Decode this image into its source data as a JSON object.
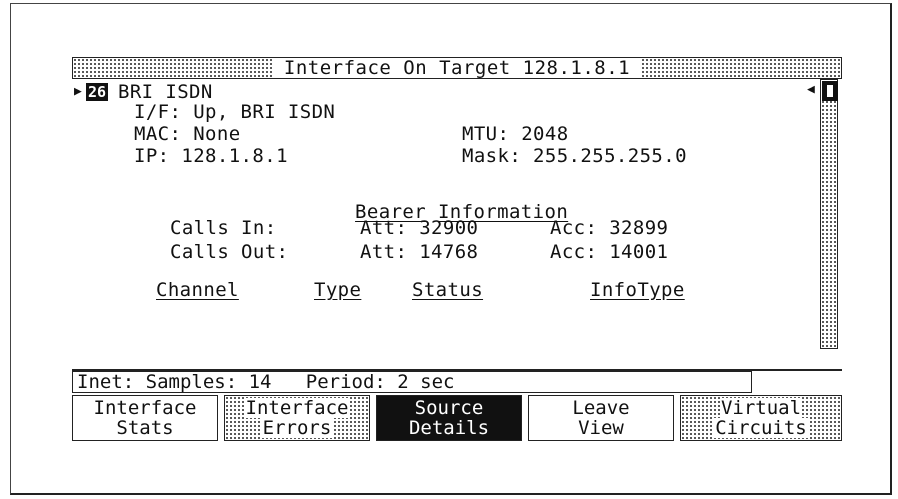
{
  "window": {
    "title": "Interface On Target 128.1.8.1"
  },
  "interface": {
    "id": "26",
    "name": "BRI ISDN",
    "if_line": "I/F: Up, BRI ISDN",
    "mac_line": "MAC: None",
    "mtu_line": "MTU: 2048",
    "ip_line": "IP: 128.1.8.1",
    "mask_line": "Mask: 255.255.255.0"
  },
  "bearer": {
    "heading_word1": "Bearer",
    "heading_word2": "Information",
    "calls_in": {
      "label": "Calls In:",
      "att": "Att: 32900",
      "acc": "Acc: 32899"
    },
    "calls_out": {
      "label": "Calls Out:",
      "att": "Att: 14768",
      "acc": "Acc: 14001"
    }
  },
  "table": {
    "headers": [
      "Channel",
      "Type",
      "Status",
      "InfoType"
    ]
  },
  "status_line": "Inet: Samples: 14   Period: 2 sec",
  "softkeys": [
    {
      "line1": "Interface",
      "line2": "Stats"
    },
    {
      "line1": "Interface",
      "line2": "Errors"
    },
    {
      "line1": "Source",
      "line2": "Details"
    },
    {
      "line1": "Leave",
      "line2": "View"
    },
    {
      "line1": "Virtual",
      "line2": "Circuits"
    }
  ],
  "icons": {
    "row_marker": "right-triangle",
    "scroll_left": "left-triangle"
  }
}
